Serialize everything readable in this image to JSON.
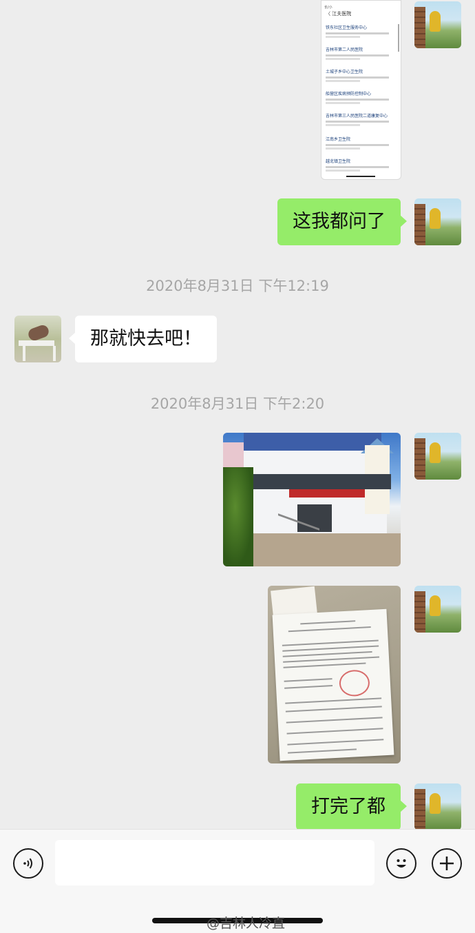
{
  "chat": {
    "screenshot_card": {
      "status": "长/小",
      "header": "〈 江夫医院",
      "items": [
        "铁东社区卫生服务中心",
        "吉林市第二人民医院",
        "土城子乡中心卫生院",
        "船营区疾病预防控制中心",
        "吉林市第三人民医院二道康复中心",
        "江南乡卫生院",
        "越北镇卫生院"
      ]
    },
    "messages": [
      {
        "text": "这我都问了"
      },
      {
        "timestamp": "2020年8月31日 下午12:19"
      },
      {
        "text": "那就快去吧！"
      },
      {
        "timestamp": "2020年8月31日 下午2:20"
      },
      {
        "text": "打完了都"
      }
    ]
  },
  "input_bar": {
    "text_value": "",
    "watermark": "@吉林人冷直"
  },
  "colors": {
    "my_bubble": "#95ec69",
    "their_bubble": "#ffffff",
    "background": "#ededed"
  },
  "icons": {
    "voice": "voice-icon",
    "emoji": "emoji-icon",
    "plus": "plus-icon"
  }
}
